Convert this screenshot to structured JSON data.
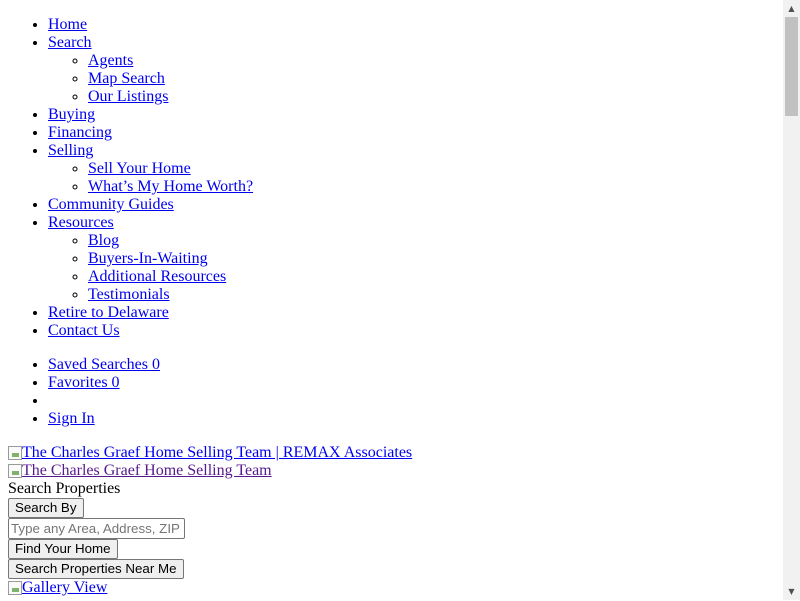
{
  "nav": {
    "home": "Home",
    "search": "Search",
    "search_sub": [
      "Agents",
      "Map Search",
      "Our Listings"
    ],
    "buying": "Buying",
    "financing": "Financing",
    "selling": "Selling",
    "selling_sub": [
      "Sell Your Home",
      "What’s My Home Worth?"
    ],
    "community": "Community Guides",
    "resources": "Resources",
    "resources_sub": [
      "Blog",
      "Buyers-In-Waiting",
      "Additional Resources",
      "Testimonials"
    ],
    "retire": "Retire to Delaware",
    "contact": "Contact Us"
  },
  "utility": {
    "saved_searches": "Saved Searches 0",
    "favorites": "Favorites 0",
    "blank": "",
    "sign_in": "Sign In"
  },
  "logos": {
    "main_alt": "The Charles Graef Home Selling Team | REMAX Associates",
    "secondary_alt": "The Charles Graef Home Selling Team"
  },
  "search": {
    "title": "Search Properties",
    "search_by": "Search By",
    "placeholder": "Type any Area, Address, ZIP",
    "find_home": "Find Your Home",
    "near_me": "Search Properties Near Me"
  },
  "gallery": {
    "alt": "Gallery View"
  },
  "icons": {
    "broken_image": "broken-image-icon",
    "scroll_up": "scroll-up-arrow-icon",
    "scroll_down": "scroll-down-arrow-icon"
  }
}
